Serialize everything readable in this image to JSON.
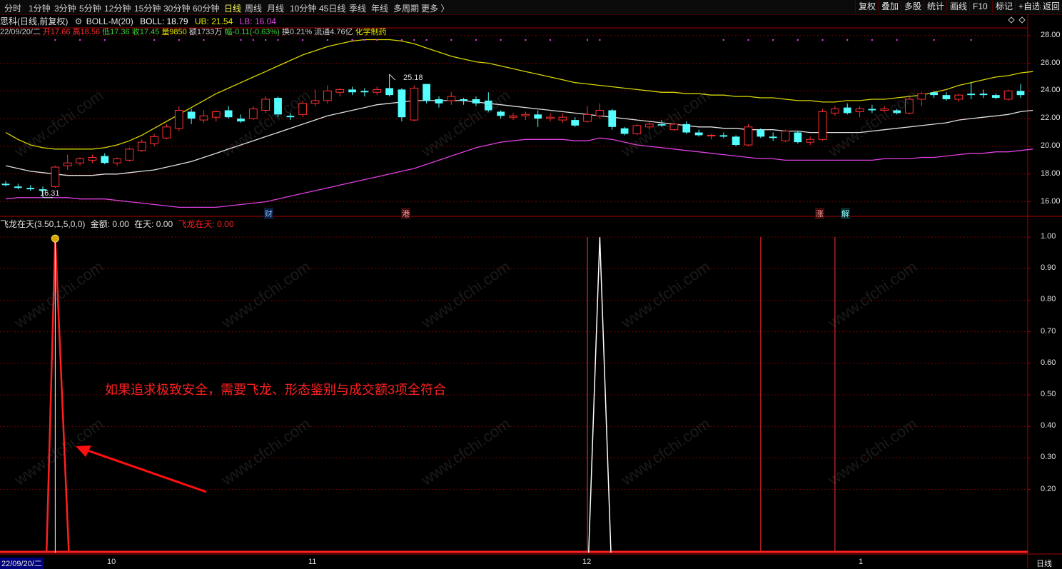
{
  "toolbar": {
    "timeframes": [
      "分时",
      "1分钟",
      "3分钟",
      "5分钟",
      "12分钟",
      "15分钟",
      "30分钟",
      "60分钟",
      "日线",
      "周线",
      "月线",
      "10分钟",
      "45日线",
      "季线",
      "年线",
      "多周期",
      "更多 〉"
    ],
    "active": "日线",
    "right_buttons": [
      "复权",
      "叠加",
      "多股",
      "统计",
      "画线",
      "F10",
      "标记",
      "+自选",
      "返回"
    ]
  },
  "info": {
    "stock": "思科(日线,前复权)",
    "indicator": "BOLL-M(20)",
    "boll": "BOLL: 18.79",
    "ub": "UB: 21.54",
    "lb": "LB: 16.04"
  },
  "ohlc": {
    "date": "22/09/20/二",
    "open": "开17.66",
    "high": "高18.56",
    "low": "低17.36",
    "close": "收17.45",
    "volume": "量9850",
    "amount": "额1733万",
    "change": "幅-0.11(-0.63%)",
    "turnover": "换0.21%",
    "float": "流通4.76亿",
    "sector": "化学制药"
  },
  "indicator_panel": {
    "title": "飞龙在天(3.50,1,5,0,0)",
    "amount": "金额: 0.00",
    "zaitian": "在天: 0.00",
    "feilong": "飞龙在天: 0.00"
  },
  "annotation": "如果追求极致安全，需要飞龙、形态鉴别与成交额3项全符合",
  "markers": {
    "high_label": "25.18",
    "low_label": "16.31",
    "event_tags": [
      "财",
      "港",
      "涨",
      "解"
    ]
  },
  "watermark": "www.cfchi.com",
  "colors": {
    "up": "#ff3030",
    "down": "#54ffff",
    "ub": "#d6d600",
    "mid": "#e0e0e0",
    "lb": "#e040e0",
    "grid": "#7a0000"
  },
  "chart_data": [
    {
      "type": "candlestick",
      "title": "",
      "ylim": [
        15.0,
        28.5
      ],
      "y_ticks": [
        "28.00",
        "26.00",
        "24.00",
        "22.00",
        "20.00",
        "18.00",
        "16.00"
      ],
      "candles": [
        {
          "o": 17.3,
          "h": 17.5,
          "l": 17.1,
          "c": 17.2
        },
        {
          "o": 17.1,
          "h": 17.3,
          "l": 16.9,
          "c": 17.0
        },
        {
          "o": 17.0,
          "h": 17.2,
          "l": 16.8,
          "c": 16.9
        },
        {
          "o": 16.9,
          "h": 17.1,
          "l": 16.3,
          "c": 16.8
        },
        {
          "o": 17.1,
          "h": 18.6,
          "l": 17.0,
          "c": 18.5
        },
        {
          "o": 18.6,
          "h": 19.4,
          "l": 18.3,
          "c": 18.8
        },
        {
          "o": 18.8,
          "h": 19.2,
          "l": 18.6,
          "c": 19.1
        },
        {
          "o": 19.0,
          "h": 19.4,
          "l": 18.8,
          "c": 19.2
        },
        {
          "o": 19.3,
          "h": 19.5,
          "l": 18.7,
          "c": 18.8
        },
        {
          "o": 18.8,
          "h": 19.2,
          "l": 18.6,
          "c": 19.1
        },
        {
          "o": 19.0,
          "h": 19.9,
          "l": 18.9,
          "c": 19.8
        },
        {
          "o": 19.7,
          "h": 20.5,
          "l": 19.6,
          "c": 20.3
        },
        {
          "o": 20.2,
          "h": 20.9,
          "l": 20.0,
          "c": 20.7
        },
        {
          "o": 20.6,
          "h": 21.6,
          "l": 20.5,
          "c": 21.4
        },
        {
          "o": 21.3,
          "h": 22.9,
          "l": 21.1,
          "c": 22.6
        },
        {
          "o": 22.5,
          "h": 22.7,
          "l": 21.6,
          "c": 22.0
        },
        {
          "o": 21.9,
          "h": 22.6,
          "l": 21.7,
          "c": 22.2
        },
        {
          "o": 22.1,
          "h": 22.6,
          "l": 21.8,
          "c": 22.5
        },
        {
          "o": 22.6,
          "h": 22.9,
          "l": 22.0,
          "c": 22.1
        },
        {
          "o": 22.0,
          "h": 22.3,
          "l": 21.7,
          "c": 21.8
        },
        {
          "o": 22.0,
          "h": 22.9,
          "l": 21.9,
          "c": 22.7
        },
        {
          "o": 22.6,
          "h": 23.6,
          "l": 22.4,
          "c": 23.4
        },
        {
          "o": 23.5,
          "h": 23.6,
          "l": 22.1,
          "c": 22.3
        },
        {
          "o": 22.2,
          "h": 22.4,
          "l": 21.9,
          "c": 22.1
        },
        {
          "o": 22.3,
          "h": 23.3,
          "l": 22.1,
          "c": 23.1
        },
        {
          "o": 23.1,
          "h": 24.1,
          "l": 22.9,
          "c": 23.3
        },
        {
          "o": 23.3,
          "h": 24.4,
          "l": 23.1,
          "c": 24.0
        },
        {
          "o": 23.9,
          "h": 24.2,
          "l": 23.6,
          "c": 24.1
        },
        {
          "o": 24.1,
          "h": 24.3,
          "l": 23.7,
          "c": 23.9
        },
        {
          "o": 24.0,
          "h": 24.2,
          "l": 23.6,
          "c": 23.9
        },
        {
          "o": 23.9,
          "h": 24.3,
          "l": 23.7,
          "c": 24.1
        },
        {
          "o": 24.2,
          "h": 25.2,
          "l": 23.6,
          "c": 23.7
        },
        {
          "o": 24.1,
          "h": 24.2,
          "l": 21.8,
          "c": 22.1
        },
        {
          "o": 21.9,
          "h": 24.4,
          "l": 21.8,
          "c": 24.2
        },
        {
          "o": 24.5,
          "h": 24.5,
          "l": 23.1,
          "c": 23.3
        },
        {
          "o": 23.4,
          "h": 23.6,
          "l": 22.8,
          "c": 23.1
        },
        {
          "o": 23.3,
          "h": 23.9,
          "l": 23.0,
          "c": 23.6
        },
        {
          "o": 23.4,
          "h": 23.5,
          "l": 23.0,
          "c": 23.3
        },
        {
          "o": 23.4,
          "h": 23.6,
          "l": 22.9,
          "c": 23.1
        },
        {
          "o": 23.3,
          "h": 23.9,
          "l": 22.5,
          "c": 22.6
        },
        {
          "o": 22.5,
          "h": 22.6,
          "l": 22.0,
          "c": 22.2
        },
        {
          "o": 22.1,
          "h": 22.4,
          "l": 21.9,
          "c": 22.2
        },
        {
          "o": 22.2,
          "h": 22.5,
          "l": 21.9,
          "c": 22.3
        },
        {
          "o": 22.3,
          "h": 22.6,
          "l": 21.4,
          "c": 22.0
        },
        {
          "o": 22.0,
          "h": 22.4,
          "l": 21.8,
          "c": 22.1
        },
        {
          "o": 21.9,
          "h": 22.4,
          "l": 21.7,
          "c": 22.1
        },
        {
          "o": 21.9,
          "h": 22.1,
          "l": 21.4,
          "c": 21.5
        },
        {
          "o": 21.8,
          "h": 22.9,
          "l": 21.7,
          "c": 22.3
        },
        {
          "o": 22.2,
          "h": 23.1,
          "l": 22.0,
          "c": 22.6
        },
        {
          "o": 22.6,
          "h": 22.7,
          "l": 21.2,
          "c": 21.4
        },
        {
          "o": 21.3,
          "h": 21.4,
          "l": 20.8,
          "c": 20.9
        },
        {
          "o": 20.9,
          "h": 21.6,
          "l": 20.8,
          "c": 21.5
        },
        {
          "o": 21.4,
          "h": 21.8,
          "l": 21.2,
          "c": 21.6
        },
        {
          "o": 21.6,
          "h": 21.9,
          "l": 21.4,
          "c": 21.5
        },
        {
          "o": 21.2,
          "h": 21.7,
          "l": 21.1,
          "c": 21.6
        },
        {
          "o": 21.6,
          "h": 21.8,
          "l": 20.9,
          "c": 21.0
        },
        {
          "o": 21.0,
          "h": 21.2,
          "l": 20.7,
          "c": 20.8
        },
        {
          "o": 20.8,
          "h": 20.9,
          "l": 20.5,
          "c": 20.8
        },
        {
          "o": 20.8,
          "h": 21.0,
          "l": 20.6,
          "c": 20.7
        },
        {
          "o": 20.7,
          "h": 20.8,
          "l": 20.0,
          "c": 20.1
        },
        {
          "o": 20.1,
          "h": 21.6,
          "l": 20.0,
          "c": 21.4
        },
        {
          "o": 21.2,
          "h": 21.3,
          "l": 20.6,
          "c": 20.7
        },
        {
          "o": 20.7,
          "h": 21.0,
          "l": 20.4,
          "c": 20.6
        },
        {
          "o": 20.4,
          "h": 21.2,
          "l": 20.3,
          "c": 21.1
        },
        {
          "o": 21.0,
          "h": 21.1,
          "l": 20.2,
          "c": 20.3
        },
        {
          "o": 20.3,
          "h": 20.7,
          "l": 20.1,
          "c": 20.5
        },
        {
          "o": 20.5,
          "h": 22.7,
          "l": 20.4,
          "c": 22.5
        },
        {
          "o": 22.4,
          "h": 22.9,
          "l": 22.2,
          "c": 22.7
        },
        {
          "o": 22.8,
          "h": 23.1,
          "l": 22.3,
          "c": 22.4
        },
        {
          "o": 22.5,
          "h": 22.9,
          "l": 22.1,
          "c": 22.7
        },
        {
          "o": 22.7,
          "h": 23.0,
          "l": 22.4,
          "c": 22.6
        },
        {
          "o": 22.6,
          "h": 22.9,
          "l": 22.5,
          "c": 22.7
        },
        {
          "o": 22.6,
          "h": 22.7,
          "l": 22.3,
          "c": 22.4
        },
        {
          "o": 22.4,
          "h": 23.6,
          "l": 22.3,
          "c": 23.4
        },
        {
          "o": 23.4,
          "h": 23.9,
          "l": 22.9,
          "c": 23.8
        },
        {
          "o": 23.9,
          "h": 24.0,
          "l": 23.5,
          "c": 23.7
        },
        {
          "o": 23.7,
          "h": 23.9,
          "l": 23.3,
          "c": 23.4
        },
        {
          "o": 23.4,
          "h": 23.8,
          "l": 23.2,
          "c": 23.7
        },
        {
          "o": 23.8,
          "h": 24.6,
          "l": 23.4,
          "c": 23.7
        },
        {
          "o": 23.8,
          "h": 24.1,
          "l": 23.5,
          "c": 23.7
        },
        {
          "o": 23.7,
          "h": 23.8,
          "l": 23.4,
          "c": 23.5
        },
        {
          "o": 23.4,
          "h": 24.1,
          "l": 23.3,
          "c": 24.0
        },
        {
          "o": 24.0,
          "h": 24.5,
          "l": 23.5,
          "c": 23.7
        }
      ],
      "ub": [
        21.0,
        20.5,
        20.1,
        19.9,
        19.8,
        19.8,
        19.8,
        19.8,
        19.9,
        20.1,
        20.4,
        20.8,
        21.3,
        21.8,
        22.3,
        22.8,
        23.3,
        23.8,
        24.2,
        24.6,
        25.0,
        25.4,
        25.8,
        26.2,
        26.6,
        26.9,
        27.2,
        27.4,
        27.6,
        27.7,
        27.7,
        27.7,
        27.6,
        27.4,
        27.1,
        26.8,
        26.5,
        26.3,
        26.1,
        26.0,
        25.8,
        25.6,
        25.4,
        25.2,
        25.0,
        24.8,
        24.6,
        24.5,
        24.4,
        24.3,
        24.2,
        24.1,
        24.0,
        23.9,
        23.9,
        23.8,
        23.8,
        23.7,
        23.7,
        23.6,
        23.6,
        23.5,
        23.5,
        23.4,
        23.3,
        23.3,
        23.2,
        23.2,
        23.3,
        23.3,
        23.4,
        23.4,
        23.5,
        23.6,
        23.7,
        23.9,
        24.1,
        24.4,
        24.6,
        24.8,
        25.0,
        25.1,
        25.3,
        25.4
      ],
      "mid": [
        18.6,
        18.4,
        18.2,
        18.1,
        18.0,
        17.9,
        17.9,
        17.9,
        18.0,
        18.0,
        18.1,
        18.2,
        18.3,
        18.5,
        18.7,
        18.9,
        19.2,
        19.5,
        19.8,
        20.1,
        20.4,
        20.7,
        21.0,
        21.3,
        21.6,
        21.9,
        22.2,
        22.4,
        22.6,
        22.8,
        23.0,
        23.1,
        23.2,
        23.3,
        23.3,
        23.3,
        23.3,
        23.3,
        23.2,
        23.1,
        23.0,
        22.9,
        22.8,
        22.7,
        22.6,
        22.5,
        22.4,
        22.3,
        22.2,
        22.1,
        22.0,
        21.9,
        21.8,
        21.7,
        21.6,
        21.5,
        21.4,
        21.4,
        21.3,
        21.3,
        21.2,
        21.2,
        21.2,
        21.1,
        21.1,
        21.0,
        21.0,
        21.0,
        21.0,
        21.0,
        21.1,
        21.2,
        21.3,
        21.4,
        21.5,
        21.6,
        21.7,
        21.9,
        22.0,
        22.1,
        22.2,
        22.3,
        22.5,
        22.6
      ],
      "lb": [
        16.2,
        16.3,
        16.3,
        16.3,
        16.3,
        16.3,
        16.2,
        16.2,
        16.2,
        16.1,
        16.0,
        15.9,
        15.8,
        15.7,
        15.6,
        15.6,
        15.6,
        15.6,
        15.7,
        15.8,
        15.9,
        16.0,
        16.2,
        16.4,
        16.6,
        16.8,
        17.0,
        17.2,
        17.4,
        17.6,
        17.8,
        18.0,
        18.2,
        18.4,
        18.7,
        19.0,
        19.3,
        19.6,
        19.9,
        20.1,
        20.3,
        20.4,
        20.5,
        20.5,
        20.5,
        20.5,
        20.4,
        20.4,
        20.6,
        20.5,
        20.3,
        20.1,
        20.0,
        19.9,
        19.8,
        19.7,
        19.6,
        19.5,
        19.4,
        19.3,
        19.2,
        19.1,
        19.1,
        19.0,
        19.0,
        19.0,
        19.0,
        19.0,
        19.0,
        19.0,
        19.0,
        19.1,
        19.1,
        19.1,
        19.2,
        19.2,
        19.3,
        19.4,
        19.5,
        19.5,
        19.6,
        19.6,
        19.7,
        19.8
      ]
    },
    {
      "type": "line",
      "title": "",
      "ylim": [
        0,
        1.05
      ],
      "y_ticks": [
        "1.00",
        "0.90",
        "0.80",
        "0.70",
        "0.60",
        "0.50",
        "0.40",
        "0.30",
        "0.20"
      ],
      "x_ticks": [
        "22/09/20/二",
        "10",
        "11",
        "12",
        "1",
        "日线"
      ],
      "signal_peaks": [
        4,
        48
      ],
      "vertical_markers": [
        47,
        61,
        67
      ]
    }
  ]
}
